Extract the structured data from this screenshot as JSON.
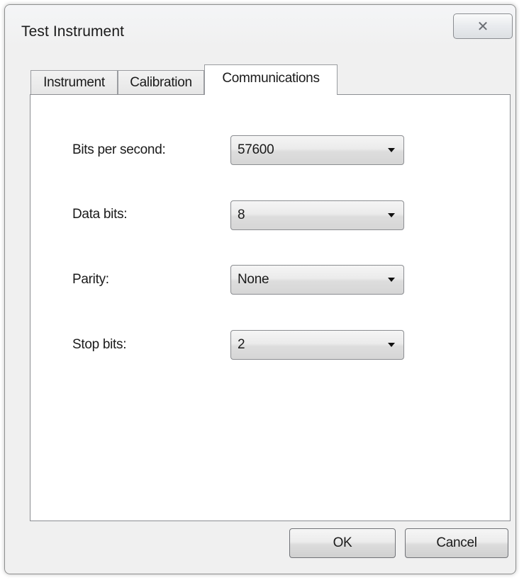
{
  "window": {
    "title": "Test Instrument",
    "close_glyph": "✕"
  },
  "tabs": [
    {
      "label": "Instrument",
      "active": false
    },
    {
      "label": "Calibration",
      "active": false
    },
    {
      "label": "Communications",
      "active": true
    }
  ],
  "fields": [
    {
      "label": "Bits per second:",
      "value": "57600"
    },
    {
      "label": "Data bits:",
      "value": "8"
    },
    {
      "label": "Parity:",
      "value": "None"
    },
    {
      "label": "Stop bits:",
      "value": "2"
    }
  ],
  "buttons": {
    "ok_label": "OK",
    "cancel_label": "Cancel"
  },
  "icons": {
    "close": "close-icon",
    "dropdown": "chevron-down-icon"
  }
}
